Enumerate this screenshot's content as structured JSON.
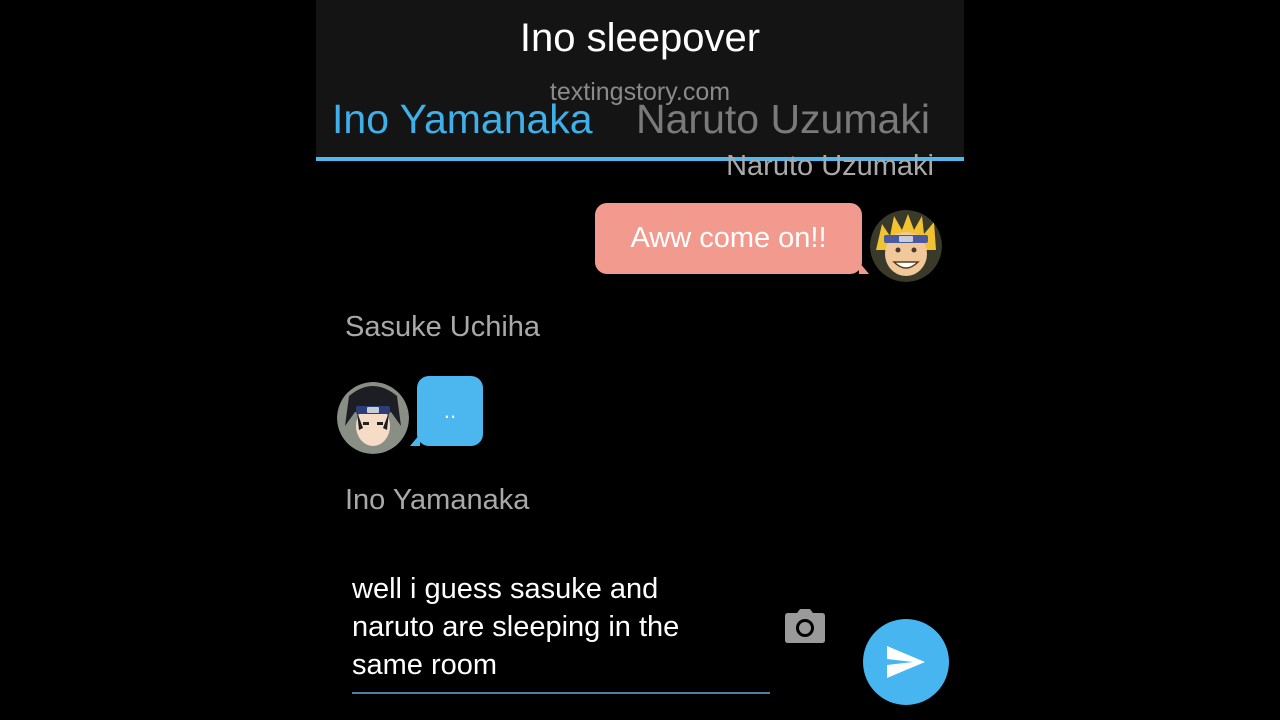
{
  "header": {
    "title": "Ino sleepover",
    "watermark": "textingstory.com",
    "tabs": [
      {
        "label": "Ino Yamanaka",
        "active": true
      },
      {
        "label": "Naruto Uzumaki",
        "active": false
      }
    ],
    "accent_color": "#3fb1ea"
  },
  "messages": [
    {
      "sender": "Naruto Uzumaki",
      "text": "Aww come on!!",
      "side": "right",
      "bubble_color": "#f29a8d",
      "avatar": "naruto-avatar"
    },
    {
      "sender": "Sasuke Uchiha",
      "text": "..",
      "side": "left",
      "bubble_color": "#4cb6ef",
      "avatar": "sasuke-avatar"
    }
  ],
  "composer": {
    "sender": "Ino Yamanaka",
    "lines": [
      "well i guess sasuke and",
      "naruto are sleeping in the",
      "same room"
    ],
    "camera_icon": "camera-icon",
    "send_icon": "send-icon"
  }
}
